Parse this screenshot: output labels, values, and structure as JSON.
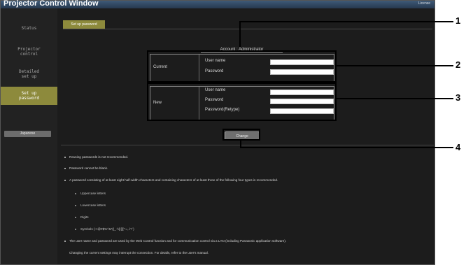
{
  "window": {
    "title": "Projector Control Window",
    "license": "License"
  },
  "sidebar": {
    "items": [
      {
        "label": "Status"
      },
      {
        "label": "Projector\ncontrol"
      },
      {
        "label": "Detailed\nset up"
      },
      {
        "label": "Set up\npassword"
      }
    ],
    "language_button": "Japanese"
  },
  "main": {
    "tab_label": "Set up password",
    "account_title": "Account : Administrator",
    "current": {
      "label": "Current",
      "user_name_label": "User name",
      "password_label": "Password",
      "user_name_value": "",
      "password_value": ""
    },
    "new": {
      "label": "New",
      "user_name_label": "User name",
      "password_label": "Password",
      "password_retype_label": "Password(Retype)",
      "user_name_value": "",
      "password_value": "",
      "password_retype_value": ""
    },
    "change_button": "Change"
  },
  "notes": {
    "n1": "Reusing passwords is not recommended.",
    "n2": "Password cannot be blank.",
    "n3": "A password consisting of at least eight half-width characters and containing characters of at least three of the following four types is recommended.",
    "types": [
      "Uppercase letters",
      "Lowercase letters",
      "Digits",
      "Symbols (~!@#$%^&*()_+\\|}{][\":=,./?`)"
    ],
    "n4": "The user name and password are used by the Web Control function and for communication control via a LAN (including Panasonic application software).",
    "n5": "Changing the current settings may interrupt the connection. For details, refer to the user's manual."
  },
  "callouts": [
    "1",
    "2",
    "3",
    "4"
  ]
}
